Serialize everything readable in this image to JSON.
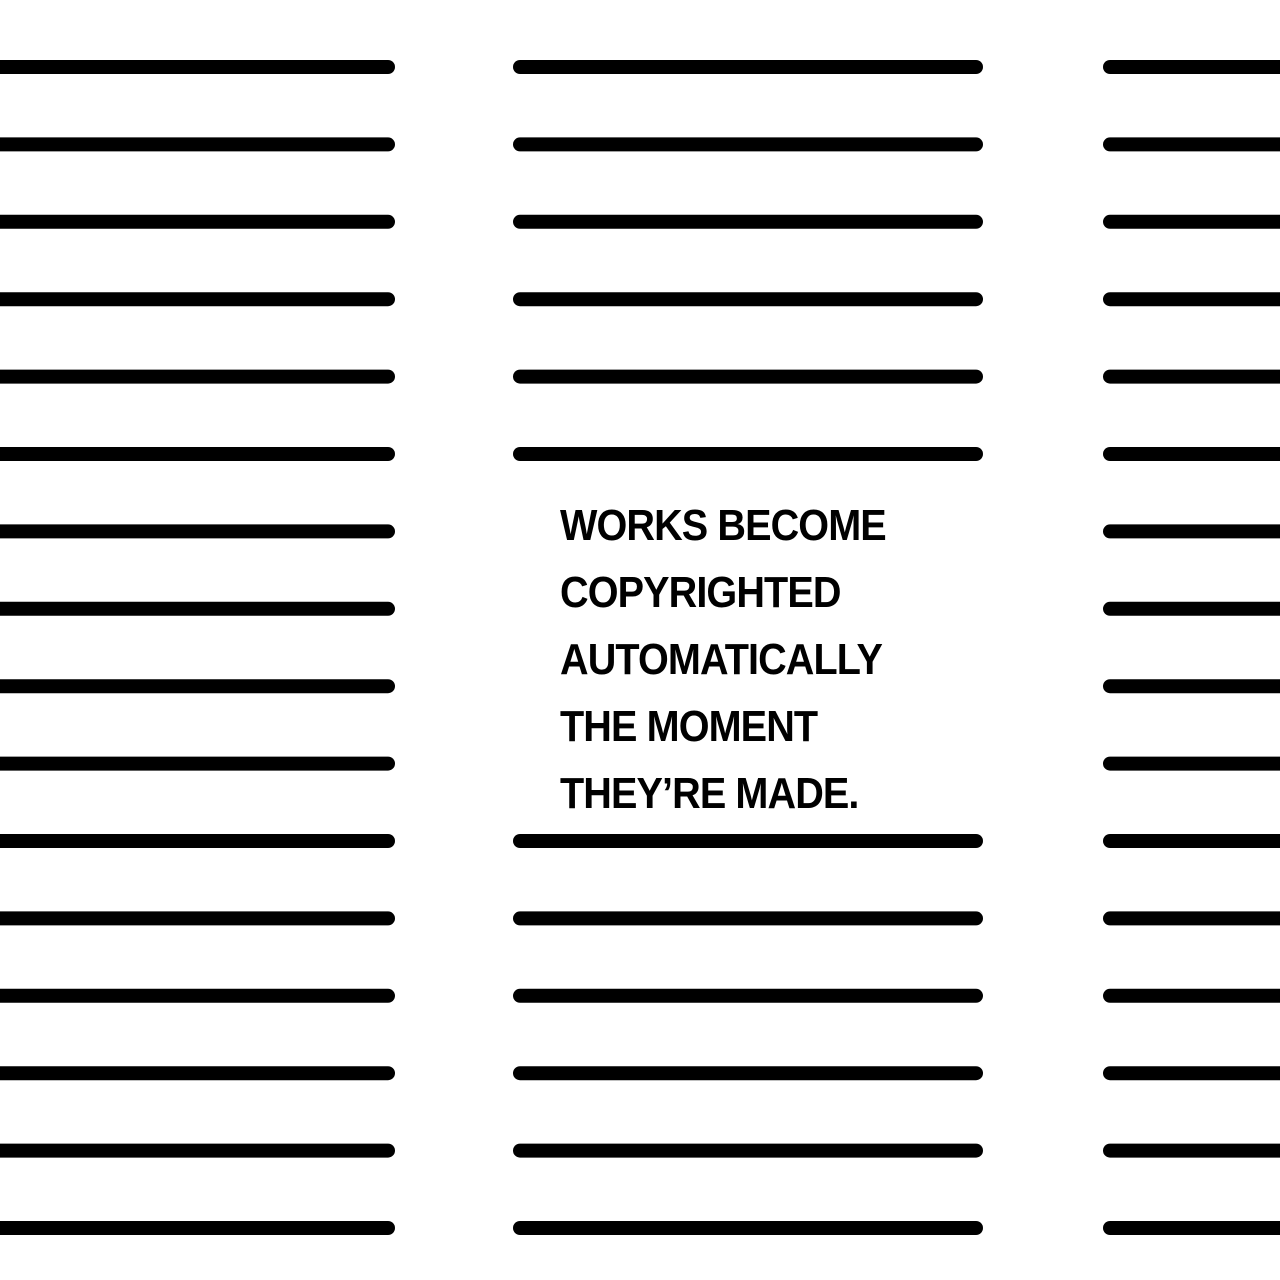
{
  "colors": {
    "background": "#ffffff",
    "ink": "#000000"
  },
  "message": {
    "lines": [
      "WORKS BECOME",
      "COPYRIGHTED",
      "AUTOMATICALLY",
      "THE MOMENT",
      "THEY’RE MADE."
    ]
  }
}
